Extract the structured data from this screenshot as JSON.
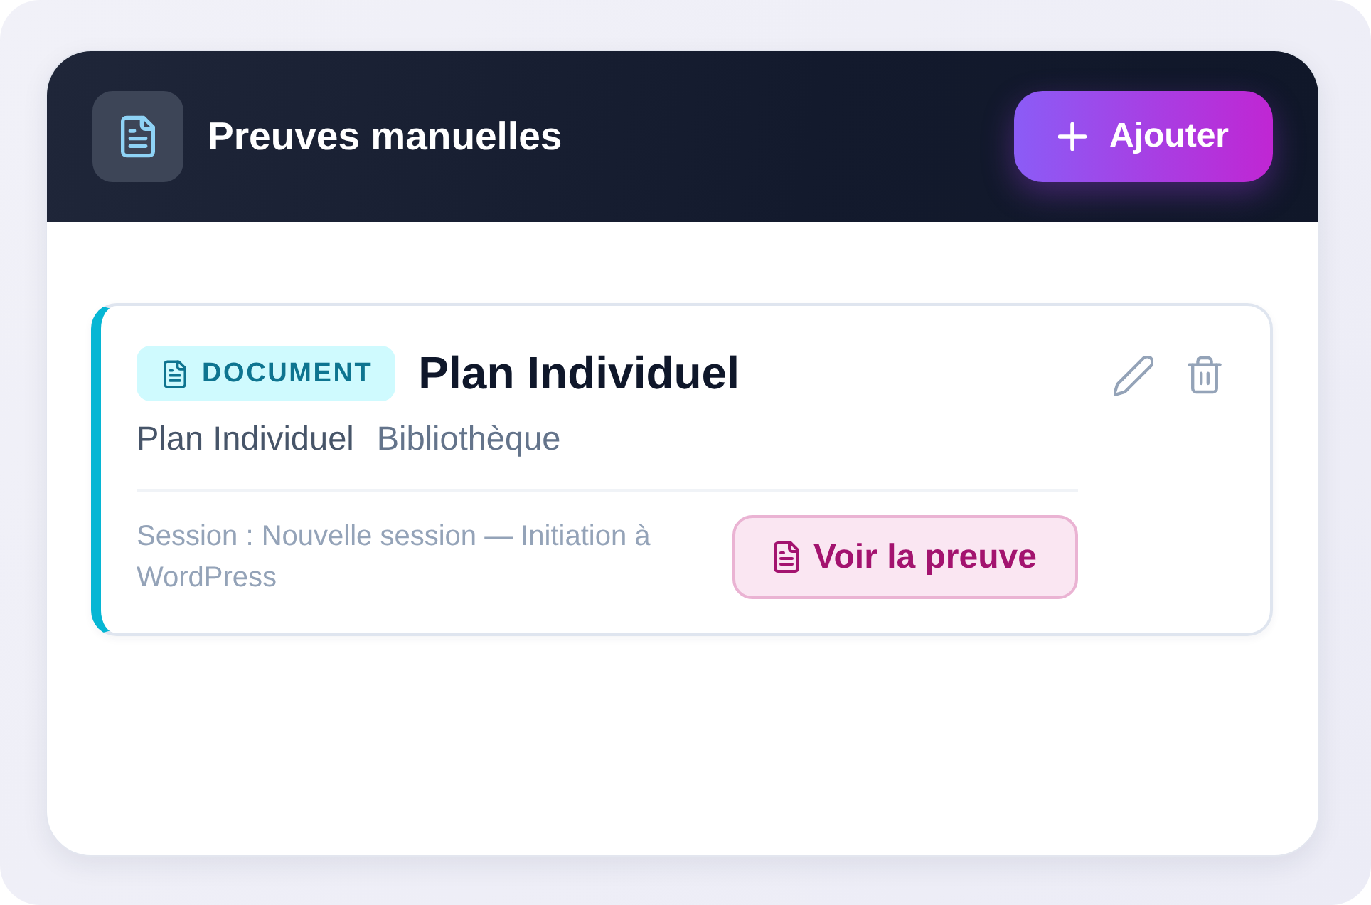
{
  "panel": {
    "title": "Preuves manuelles",
    "add_button": {
      "label": "Ajouter"
    }
  },
  "proofs": [
    {
      "kind": "document",
      "badge": "DOCUMENT",
      "title": "Plan Individuel",
      "subtitle": "Plan Individuel",
      "source": "Bibliothèque",
      "session": "Session : Nouvelle session — Initiation à WordPress",
      "view_button": {
        "label": "Voir la preuve"
      }
    }
  ]
}
